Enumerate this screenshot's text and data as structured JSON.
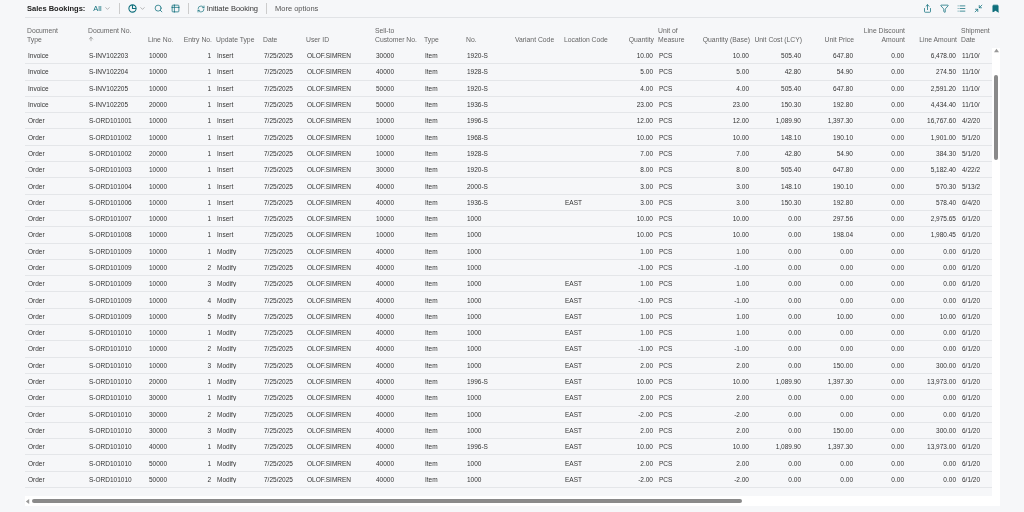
{
  "toolbar": {
    "title": "Sales Bookings:",
    "view": "All",
    "actions": [
      {
        "kind": "icon-menu"
      },
      {
        "kind": "search"
      },
      {
        "kind": "edit-list"
      },
      {
        "kind": "divider"
      },
      {
        "kind": "command",
        "label": "Initiate Booking"
      },
      {
        "kind": "divider"
      },
      {
        "kind": "text",
        "label": "More options"
      }
    ]
  },
  "table": {
    "columns": [
      {
        "label": "Document\nType",
        "sorted": false
      },
      {
        "label": "Document No.",
        "sorted": true
      },
      {
        "label": "Line No.",
        "sorted": false
      },
      {
        "label": "Entry No.",
        "sorted": false
      },
      {
        "label": "Update Type",
        "sorted": false
      },
      {
        "label": "Date",
        "sorted": false
      },
      {
        "label": "User ID",
        "sorted": false
      },
      {
        "label": "Sell-to\nCustomer No.",
        "sorted": false
      },
      {
        "label": "Type",
        "sorted": false
      },
      {
        "label": "No.",
        "sorted": false
      },
      {
        "label": "Variant Code",
        "sorted": false
      },
      {
        "label": "Location Code",
        "sorted": false
      },
      {
        "label": "Quantity",
        "sorted": false
      },
      {
        "label": "Unit of\nMeasure",
        "sorted": false
      },
      {
        "label": "Quantity (Base)",
        "sorted": false
      },
      {
        "label": "Unit Cost (LCY)",
        "sorted": false
      },
      {
        "label": "Unit Price",
        "sorted": false
      },
      {
        "label": "Line Discount\nAmount",
        "sorted": false
      },
      {
        "label": "Line Amount",
        "sorted": false
      },
      {
        "label": "Shipment\nDate",
        "sorted": false
      }
    ],
    "rows": [
      [
        "Invoice",
        "S-INV102203",
        "10000",
        "1",
        "Insert",
        "7/25/2025",
        "OLOF.SIMREN",
        "30000",
        "Item",
        "1920-S",
        null,
        null,
        "10.00",
        "PCS",
        "10.00",
        "505.40",
        "647.80",
        "0.00",
        "6,478.00",
        "11/10/"
      ],
      [
        "Invoice",
        "S-INV102204",
        "10000",
        "1",
        "Insert",
        "7/25/2025",
        "OLOF.SIMREN",
        "40000",
        "Item",
        "1928-S",
        null,
        null,
        "5.00",
        "PCS",
        "5.00",
        "42.80",
        "54.90",
        "0.00",
        "274.50",
        "11/10/"
      ],
      [
        "Invoice",
        "S-INV102205",
        "10000",
        "1",
        "Insert",
        "7/25/2025",
        "OLOF.SIMREN",
        "50000",
        "Item",
        "1920-S",
        null,
        null,
        "4.00",
        "PCS",
        "4.00",
        "505.40",
        "647.80",
        "0.00",
        "2,591.20",
        "11/10/"
      ],
      [
        "Invoice",
        "S-INV102205",
        "20000",
        "1",
        "Insert",
        "7/25/2025",
        "OLOF.SIMREN",
        "50000",
        "Item",
        "1936-S",
        null,
        null,
        "23.00",
        "PCS",
        "23.00",
        "150.30",
        "192.80",
        "0.00",
        "4,434.40",
        "11/10/"
      ],
      [
        "Order",
        "S-ORD101001",
        "10000",
        "1",
        "Insert",
        "7/25/2025",
        "OLOF.SIMREN",
        "10000",
        "Item",
        "1996-S",
        null,
        null,
        "12.00",
        "PCS",
        "12.00",
        "1,089.90",
        "1,397.30",
        "0.00",
        "16,767.60",
        "4/2/20"
      ],
      [
        "Order",
        "S-ORD101002",
        "10000",
        "1",
        "Insert",
        "7/25/2025",
        "OLOF.SIMREN",
        "10000",
        "Item",
        "1968-S",
        null,
        null,
        "10.00",
        "PCS",
        "10.00",
        "148.10",
        "190.10",
        "0.00",
        "1,901.00",
        "5/1/20"
      ],
      [
        "Order",
        "S-ORD101002",
        "20000",
        "1",
        "Insert",
        "7/25/2025",
        "OLOF.SIMREN",
        "10000",
        "Item",
        "1928-S",
        null,
        null,
        "7.00",
        "PCS",
        "7.00",
        "42.80",
        "54.90",
        "0.00",
        "384.30",
        "5/1/20"
      ],
      [
        "Order",
        "S-ORD101003",
        "10000",
        "1",
        "Insert",
        "7/25/2025",
        "OLOF.SIMREN",
        "30000",
        "Item",
        "1920-S",
        null,
        null,
        "8.00",
        "PCS",
        "8.00",
        "505.40",
        "647.80",
        "0.00",
        "5,182.40",
        "4/22/2"
      ],
      [
        "Order",
        "S-ORD101004",
        "10000",
        "1",
        "Insert",
        "7/25/2025",
        "OLOF.SIMREN",
        "40000",
        "Item",
        "2000-S",
        null,
        null,
        "3.00",
        "PCS",
        "3.00",
        "148.10",
        "190.10",
        "0.00",
        "570.30",
        "5/13/2"
      ],
      [
        "Order",
        "S-ORD101006",
        "10000",
        "1",
        "Insert",
        "7/25/2025",
        "OLOF.SIMREN",
        "40000",
        "Item",
        "1936-S",
        null,
        "EAST",
        "3.00",
        "PCS",
        "3.00",
        "150.30",
        "192.80",
        "0.00",
        "578.40",
        "6/4/20"
      ],
      [
        "Order",
        "S-ORD101007",
        "10000",
        "1",
        "Insert",
        "7/25/2025",
        "OLOF.SIMREN",
        "10000",
        "Item",
        "1000",
        null,
        null,
        "10.00",
        "PCS",
        "10.00",
        "0.00",
        "297.56",
        "0.00",
        "2,975.65",
        "6/1/20"
      ],
      [
        "Order",
        "S-ORD101008",
        "10000",
        "1",
        "Insert",
        "7/25/2025",
        "OLOF.SIMREN",
        "10000",
        "Item",
        "1000",
        null,
        null,
        "10.00",
        "PCS",
        "10.00",
        "0.00",
        "198.04",
        "0.00",
        "1,980.45",
        "6/1/20"
      ],
      [
        "Order",
        "S-ORD101009",
        "10000",
        "1",
        "Modify",
        "7/25/2025",
        "OLOF.SIMREN",
        "40000",
        "Item",
        "1000",
        null,
        null,
        "1.00",
        "PCS",
        "1.00",
        "0.00",
        "0.00",
        "0.00",
        "0.00",
        "6/1/20"
      ],
      [
        "Order",
        "S-ORD101009",
        "10000",
        "2",
        "Modify",
        "7/25/2025",
        "OLOF.SIMREN",
        "40000",
        "Item",
        "1000",
        null,
        null,
        "-1.00",
        "PCS",
        "-1.00",
        "0.00",
        "0.00",
        "0.00",
        "0.00",
        "6/1/20"
      ],
      [
        "Order",
        "S-ORD101009",
        "10000",
        "3",
        "Modify",
        "7/25/2025",
        "OLOF.SIMREN",
        "40000",
        "Item",
        "1000",
        null,
        "EAST",
        "1.00",
        "PCS",
        "1.00",
        "0.00",
        "0.00",
        "0.00",
        "0.00",
        "6/1/20"
      ],
      [
        "Order",
        "S-ORD101009",
        "10000",
        "4",
        "Modify",
        "7/25/2025",
        "OLOF.SIMREN",
        "40000",
        "Item",
        "1000",
        null,
        "EAST",
        "-1.00",
        "PCS",
        "-1.00",
        "0.00",
        "0.00",
        "0.00",
        "0.00",
        "6/1/20"
      ],
      [
        "Order",
        "S-ORD101009",
        "10000",
        "5",
        "Modify",
        "7/25/2025",
        "OLOF.SIMREN",
        "40000",
        "Item",
        "1000",
        null,
        "EAST",
        "1.00",
        "PCS",
        "1.00",
        "0.00",
        "10.00",
        "0.00",
        "10.00",
        "6/1/20"
      ],
      [
        "Order",
        "S-ORD101010",
        "10000",
        "1",
        "Modify",
        "7/25/2025",
        "OLOF.SIMREN",
        "40000",
        "Item",
        "1000",
        null,
        "EAST",
        "1.00",
        "PCS",
        "1.00",
        "0.00",
        "0.00",
        "0.00",
        "0.00",
        "6/1/20"
      ],
      [
        "Order",
        "S-ORD101010",
        "10000",
        "2",
        "Modify",
        "7/25/2025",
        "OLOF.SIMREN",
        "40000",
        "Item",
        "1000",
        null,
        "EAST",
        "-1.00",
        "PCS",
        "-1.00",
        "0.00",
        "0.00",
        "0.00",
        "0.00",
        "6/1/20"
      ],
      [
        "Order",
        "S-ORD101010",
        "10000",
        "3",
        "Modify",
        "7/25/2025",
        "OLOF.SIMREN",
        "40000",
        "Item",
        "1000",
        null,
        "EAST",
        "2.00",
        "PCS",
        "2.00",
        "0.00",
        "150.00",
        "0.00",
        "300.00",
        "6/1/20"
      ],
      [
        "Order",
        "S-ORD101010",
        "20000",
        "1",
        "Modify",
        "7/25/2025",
        "OLOF.SIMREN",
        "40000",
        "Item",
        "1996-S",
        null,
        "EAST",
        "10.00",
        "PCS",
        "10.00",
        "1,089.90",
        "1,397.30",
        "0.00",
        "13,973.00",
        "6/1/20"
      ],
      [
        "Order",
        "S-ORD101010",
        "30000",
        "1",
        "Modify",
        "7/25/2025",
        "OLOF.SIMREN",
        "40000",
        "Item",
        "1000",
        null,
        "EAST",
        "2.00",
        "PCS",
        "2.00",
        "0.00",
        "0.00",
        "0.00",
        "0.00",
        "6/1/20"
      ],
      [
        "Order",
        "S-ORD101010",
        "30000",
        "2",
        "Modify",
        "7/25/2025",
        "OLOF.SIMREN",
        "40000",
        "Item",
        "1000",
        null,
        "EAST",
        "-2.00",
        "PCS",
        "-2.00",
        "0.00",
        "0.00",
        "0.00",
        "0.00",
        "6/1/20"
      ],
      [
        "Order",
        "S-ORD101010",
        "30000",
        "3",
        "Modify",
        "7/25/2025",
        "OLOF.SIMREN",
        "40000",
        "Item",
        "1000",
        null,
        "EAST",
        "2.00",
        "PCS",
        "2.00",
        "0.00",
        "150.00",
        "0.00",
        "300.00",
        "6/1/20"
      ],
      [
        "Order",
        "S-ORD101010",
        "40000",
        "1",
        "Modify",
        "7/25/2025",
        "OLOF.SIMREN",
        "40000",
        "Item",
        "1996-S",
        null,
        "EAST",
        "10.00",
        "PCS",
        "10.00",
        "1,089.90",
        "1,397.30",
        "0.00",
        "13,973.00",
        "6/1/20"
      ],
      [
        "Order",
        "S-ORD101010",
        "50000",
        "1",
        "Modify",
        "7/25/2025",
        "OLOF.SIMREN",
        "40000",
        "Item",
        "1000",
        null,
        "EAST",
        "2.00",
        "PCS",
        "2.00",
        "0.00",
        "0.00",
        "0.00",
        "0.00",
        "6/1/20"
      ],
      [
        "Order",
        "S-ORD101010",
        "50000",
        "2",
        "Modify",
        "7/25/2025",
        "OLOF.SIMREN",
        "40000",
        "Item",
        "1000",
        null,
        "EAST",
        "-2.00",
        "PCS",
        "-2.00",
        "0.00",
        "0.00",
        "0.00",
        "0.00",
        "6/1/20"
      ]
    ]
  }
}
